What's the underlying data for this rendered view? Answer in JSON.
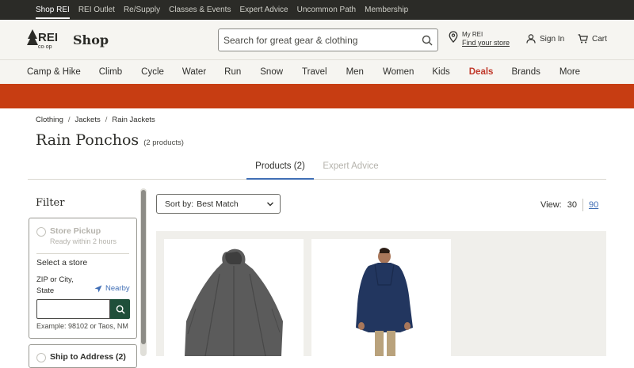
{
  "topbar": {
    "links": [
      "Shop REI",
      "REI Outlet",
      "Re/Supply",
      "Classes & Events",
      "Expert Advice",
      "Uncommon Path",
      "Membership"
    ]
  },
  "header": {
    "logo_text": "REI co-op",
    "shop_label": "Shop",
    "search_placeholder": "Search for great gear & clothing",
    "myrei_label": "My REI",
    "find_store": "Find your store",
    "signin": "Sign In",
    "cart": "Cart"
  },
  "nav": {
    "items": [
      "Camp & Hike",
      "Climb",
      "Cycle",
      "Water",
      "Run",
      "Snow",
      "Travel",
      "Men",
      "Women",
      "Kids",
      "Deals",
      "Brands",
      "More"
    ]
  },
  "breadcrumb": [
    "Clothing",
    "Jackets",
    "Rain Jackets"
  ],
  "page": {
    "title": "Rain Ponchos",
    "count": "(2 products)"
  },
  "tabs": {
    "products": "Products (2)",
    "expert": "Expert Advice"
  },
  "filter": {
    "title": "Filter",
    "pickup_title": "Store Pickup",
    "pickup_sub": "Ready within 2 hours",
    "select_store": "Select a store",
    "zip_label": "ZIP or City, State",
    "nearby": "Nearby",
    "zip_example": "Example: 98102 or Taos, NM",
    "ship_label": "Ship to Address (2)"
  },
  "sort": {
    "label": "Sort by:",
    "value": "Best Match"
  },
  "view": {
    "label": "View:",
    "opt30": "30",
    "opt90": "90"
  },
  "colors": {
    "promo": "#c73d12",
    "deals": "#c0392b",
    "link": "#406eb5",
    "search_go": "#1f4f3a"
  }
}
